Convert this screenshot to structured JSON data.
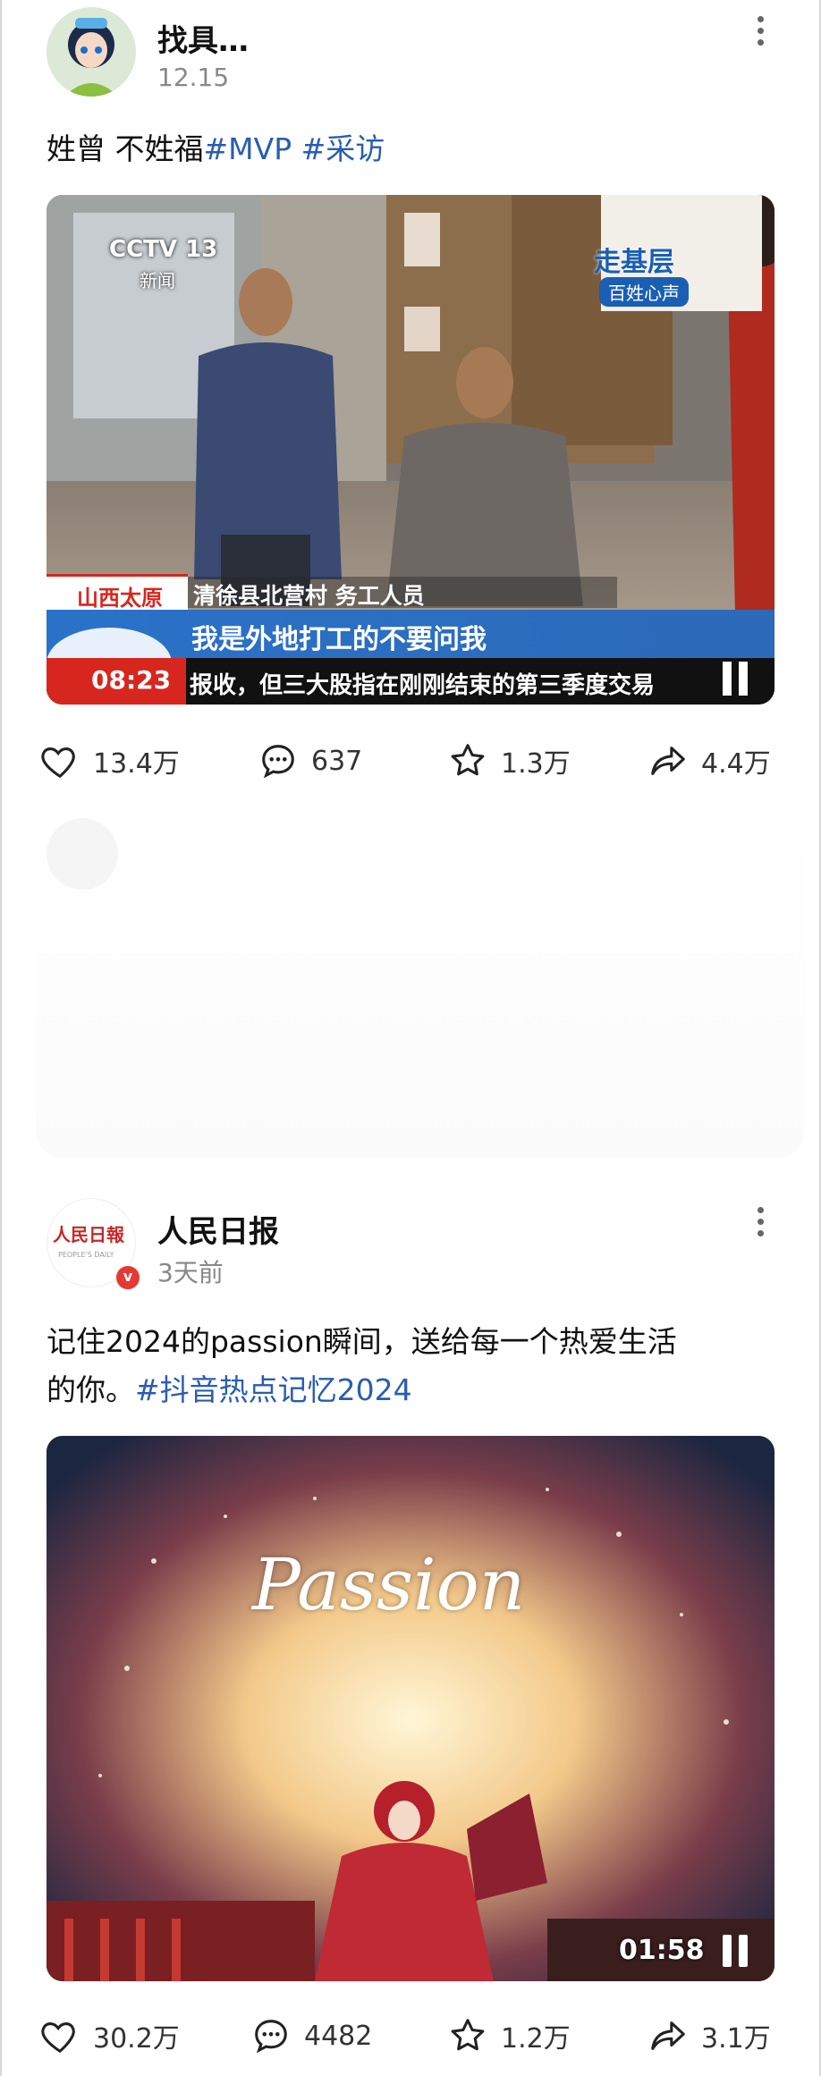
{
  "posts": [
    {
      "author": "找具…",
      "time": "12.15",
      "text": "姓曾 不姓福",
      "tags": [
        "#MVP",
        "#采访"
      ],
      "video": {
        "channel": "CCTV 13",
        "channel_sub": "新闻",
        "program": "走基层",
        "program_sub": "百姓心声",
        "location": "山西太原",
        "caption_name": "清徐县北营村 务工人员",
        "subtitle": "我是外地打工的不要问我",
        "clock": "08:23",
        "ticker": "报收，但三大股指在刚刚结束的第三季度交易"
      },
      "likes": "13.4万",
      "comments": "637",
      "favorites": "1.3万",
      "shares": "4.4万"
    },
    {
      "author": "人民日报",
      "time": "3天前",
      "avatar_text": "人民日報",
      "avatar_sub": "PEOPLE'S DAILY",
      "verified_mark": "v",
      "text_line1": "记住2024的passion瞬间，送给每一个热爱生活",
      "text_line2": "的你。",
      "tags": [
        "#抖音热点记忆2024"
      ],
      "video": {
        "title": "Passion",
        "duration": "01:58"
      },
      "likes": "30.2万",
      "comments": "4482",
      "favorites": "1.2万",
      "shares": "3.1万"
    }
  ],
  "colors": {
    "hashtag": "#2a5db0",
    "verified": "#e53935",
    "cctv_blue": "#1a5fb4",
    "cctv_red": "#d7261e"
  }
}
